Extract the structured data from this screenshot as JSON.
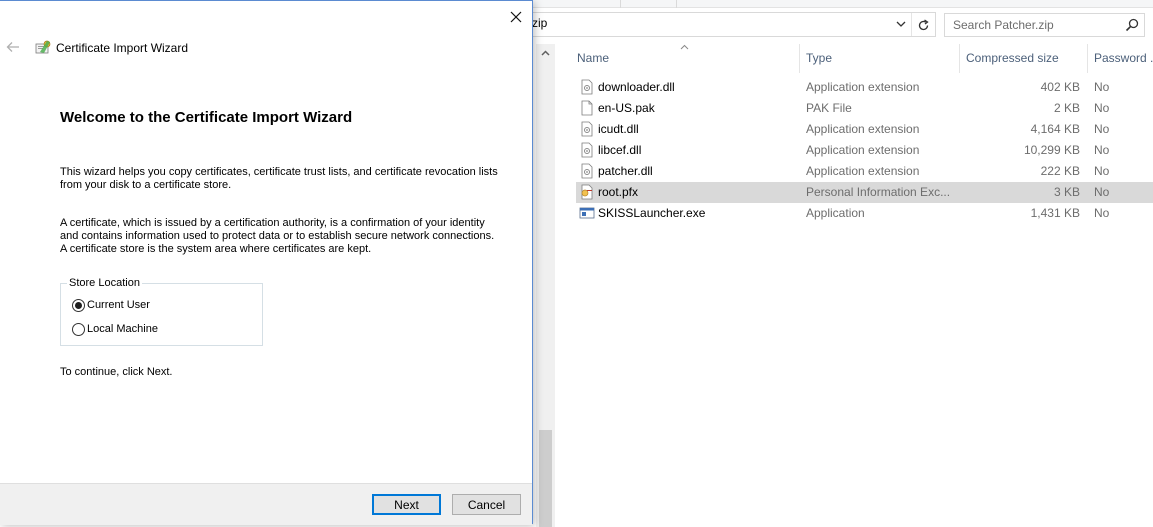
{
  "explorer": {
    "address_text": "zip",
    "search": {
      "placeholder": "Search Patcher.zip"
    },
    "columns": {
      "name": "Name",
      "type": "Type",
      "compressed_size": "Compressed size",
      "password": "Password ..."
    },
    "files": [
      {
        "name": "downloader.dll",
        "type": "Application extension",
        "size": "402 KB",
        "password": "No",
        "icon": "dll-file-icon",
        "selected": false
      },
      {
        "name": "en-US.pak",
        "type": "PAK File",
        "size": "2 KB",
        "password": "No",
        "icon": "generic-file-icon",
        "selected": false
      },
      {
        "name": "icudt.dll",
        "type": "Application extension",
        "size": "4,164 KB",
        "password": "No",
        "icon": "dll-file-icon",
        "selected": false
      },
      {
        "name": "libcef.dll",
        "type": "Application extension",
        "size": "10,299 KB",
        "password": "No",
        "icon": "dll-file-icon",
        "selected": false
      },
      {
        "name": "patcher.dll",
        "type": "Application extension",
        "size": "222 KB",
        "password": "No",
        "icon": "dll-file-icon",
        "selected": false
      },
      {
        "name": "root.pfx",
        "type": "Personal Information Exc...",
        "size": "3 KB",
        "password": "No",
        "icon": "certificate-file-icon",
        "selected": true
      },
      {
        "name": "SKISSLauncher.exe",
        "type": "Application",
        "size": "1,431 KB",
        "password": "No",
        "icon": "exe-file-icon",
        "selected": false
      }
    ]
  },
  "wizard": {
    "title": "Certificate Import Wizard",
    "heading": "Welcome to the Certificate Import Wizard",
    "para1": "This wizard helps you copy certificates, certificate trust lists, and certificate revocation lists from your disk to a certificate store.",
    "para2": "A certificate, which is issued by a certification authority, is a confirmation of your identity and contains information used to protect data or to establish secure network connections. A certificate store is the system area where certificates are kept.",
    "store_location": {
      "legend": "Store Location",
      "options": [
        {
          "label": "Current User",
          "checked": true
        },
        {
          "label": "Local Machine",
          "checked": false
        }
      ]
    },
    "continue_text": "To continue, click Next.",
    "buttons": {
      "next": "Next",
      "cancel": "Cancel"
    }
  },
  "colors": {
    "selected_row": "#d9d9d9",
    "header_text": "#4c607a",
    "dialog_border": "#5b8bd1",
    "default_button_border": "#0078d7"
  }
}
